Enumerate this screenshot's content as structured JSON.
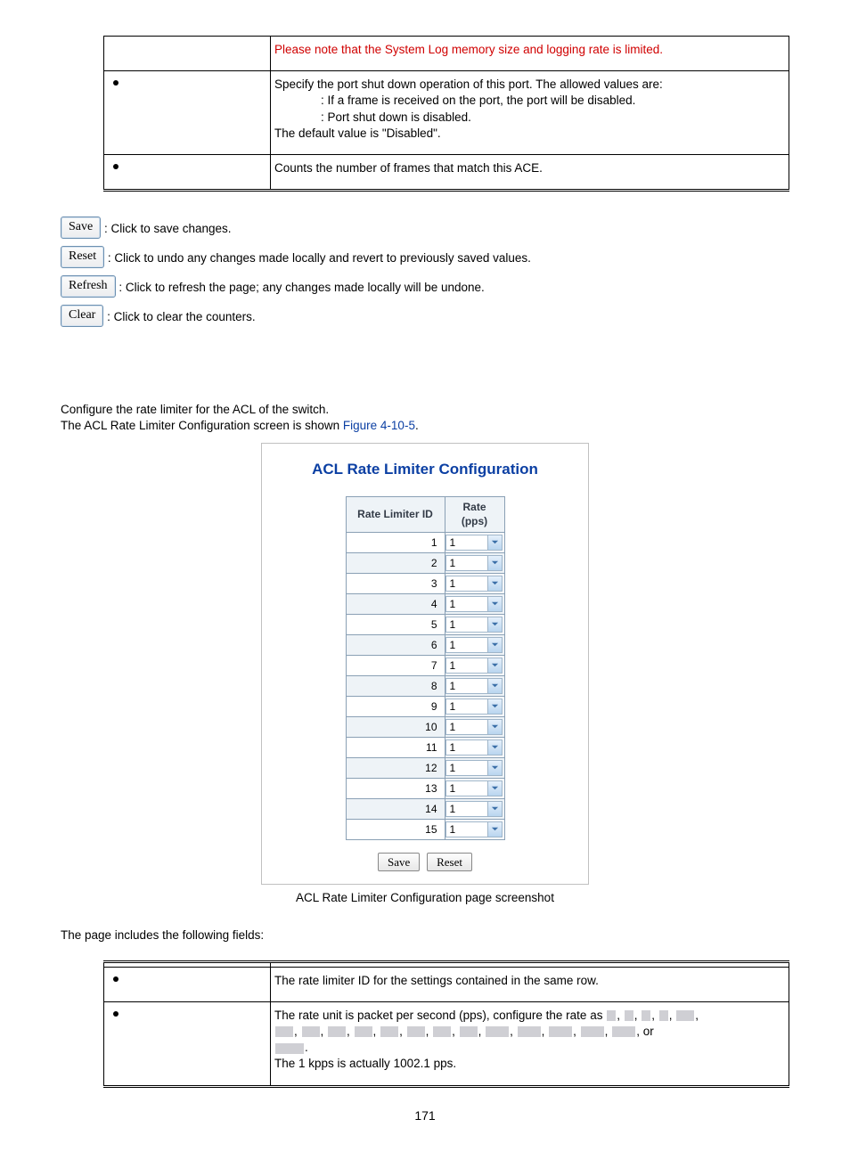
{
  "upper_table": {
    "row_note": "Please note that the System Log memory size and logging rate is limited.",
    "row_shutdown": {
      "line1": "Specify the port shut down operation of this port. The allowed values are:",
      "enabled": ": If a frame is received on the port, the port will be disabled.",
      "disabled": ": Port shut down is disabled.",
      "default": "The default value is \"Disabled\"."
    },
    "row_counter": "Counts the number of frames that match this ACE."
  },
  "buttons": {
    "save": {
      "label": "Save",
      "desc": ": Click to save changes."
    },
    "reset": {
      "label": "Reset",
      "desc": ": Click to undo any changes made locally and revert to previously saved values."
    },
    "refresh": {
      "label": "Refresh",
      "desc": ": Click to refresh the page; any changes made locally will be undone."
    },
    "clear": {
      "label": "Clear",
      "desc": ": Click to clear the counters."
    }
  },
  "acl_section": {
    "intro1": "Configure the rate limiter for the ACL of the switch.",
    "intro2_a": "The ACL Rate Limiter Configuration screen is shown ",
    "intro2_link": "Figure 4-10-5",
    "intro2_b": "."
  },
  "figure": {
    "title": "ACL Rate Limiter Configuration",
    "col_id": "Rate Limiter ID",
    "col_rate": "Rate (pps)",
    "rows": [
      {
        "id": "1",
        "rate": "1"
      },
      {
        "id": "2",
        "rate": "1"
      },
      {
        "id": "3",
        "rate": "1"
      },
      {
        "id": "4",
        "rate": "1"
      },
      {
        "id": "5",
        "rate": "1"
      },
      {
        "id": "6",
        "rate": "1"
      },
      {
        "id": "7",
        "rate": "1"
      },
      {
        "id": "8",
        "rate": "1"
      },
      {
        "id": "9",
        "rate": "1"
      },
      {
        "id": "10",
        "rate": "1"
      },
      {
        "id": "11",
        "rate": "1"
      },
      {
        "id": "12",
        "rate": "1"
      },
      {
        "id": "13",
        "rate": "1"
      },
      {
        "id": "14",
        "rate": "1"
      },
      {
        "id": "15",
        "rate": "1"
      }
    ],
    "save_btn": "Save",
    "reset_btn": "Reset",
    "caption": " ACL Rate Limiter Configuration page screenshot"
  },
  "fields_intro": "The page includes the following fields:",
  "lower_table": {
    "row1_desc": "The rate limiter ID for the settings contained in the same row.",
    "row2_line1": "The rate unit is packet per second (pps), configure the rate as ",
    "row2_or": ", or",
    "row2_line3": "The 1 kpps is actually 1002.1 pps."
  },
  "page_number": "171"
}
